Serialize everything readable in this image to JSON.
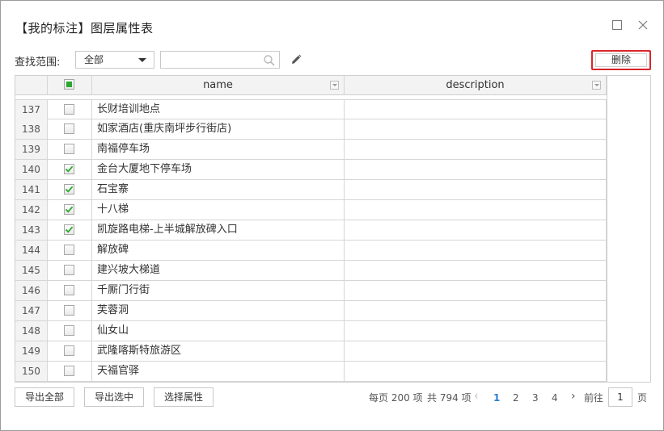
{
  "dialog": {
    "title": "【我的标注】图层属性表"
  },
  "toolbar": {
    "search_label": "查找范围:",
    "scope_value": "全部",
    "search_value": "",
    "search_placeholder": "",
    "delete_label": "删除"
  },
  "grid": {
    "columns": [
      "name",
      "description"
    ],
    "rows": [
      {
        "index": "137",
        "checked": false,
        "name": "长财培训地点",
        "description": ""
      },
      {
        "index": "138",
        "checked": false,
        "name": "如家酒店(重庆南坪步行街店)",
        "description": ""
      },
      {
        "index": "139",
        "checked": false,
        "name": "南福停车场",
        "description": ""
      },
      {
        "index": "140",
        "checked": true,
        "name": "金台大厦地下停车场",
        "description": ""
      },
      {
        "index": "141",
        "checked": true,
        "name": "石宝寨",
        "description": ""
      },
      {
        "index": "142",
        "checked": true,
        "name": "十八梯",
        "description": ""
      },
      {
        "index": "143",
        "checked": true,
        "name": "凯旋路电梯-上半城解放碑入口",
        "description": ""
      },
      {
        "index": "144",
        "checked": false,
        "name": "解放碑",
        "description": ""
      },
      {
        "index": "145",
        "checked": false,
        "name": "建兴坡大梯道",
        "description": ""
      },
      {
        "index": "146",
        "checked": false,
        "name": "千厮门行街",
        "description": ""
      },
      {
        "index": "147",
        "checked": false,
        "name": "芙蓉洞",
        "description": ""
      },
      {
        "index": "148",
        "checked": false,
        "name": "仙女山",
        "description": ""
      },
      {
        "index": "149",
        "checked": false,
        "name": "武隆喀斯特旅游区",
        "description": ""
      },
      {
        "index": "150",
        "checked": false,
        "name": "天福官驿",
        "description": ""
      }
    ]
  },
  "footer": {
    "export_all_label": "导出全部",
    "export_selected_label": "导出选中",
    "select_attrs_label": "选择属性",
    "page_size_text": "每页 200 项",
    "total_text": "共 794 项",
    "pages": [
      "1",
      "2",
      "3",
      "4"
    ],
    "current_page": "1",
    "prev_glyph": "‹",
    "next_glyph": "›",
    "goto_label": "前往",
    "goto_value": "1",
    "page_unit": "页"
  },
  "colors": {
    "accent": "#2b7fd3",
    "danger": "#d9262b",
    "check": "#2aa82e",
    "header_bg": "#f3f3f3"
  }
}
